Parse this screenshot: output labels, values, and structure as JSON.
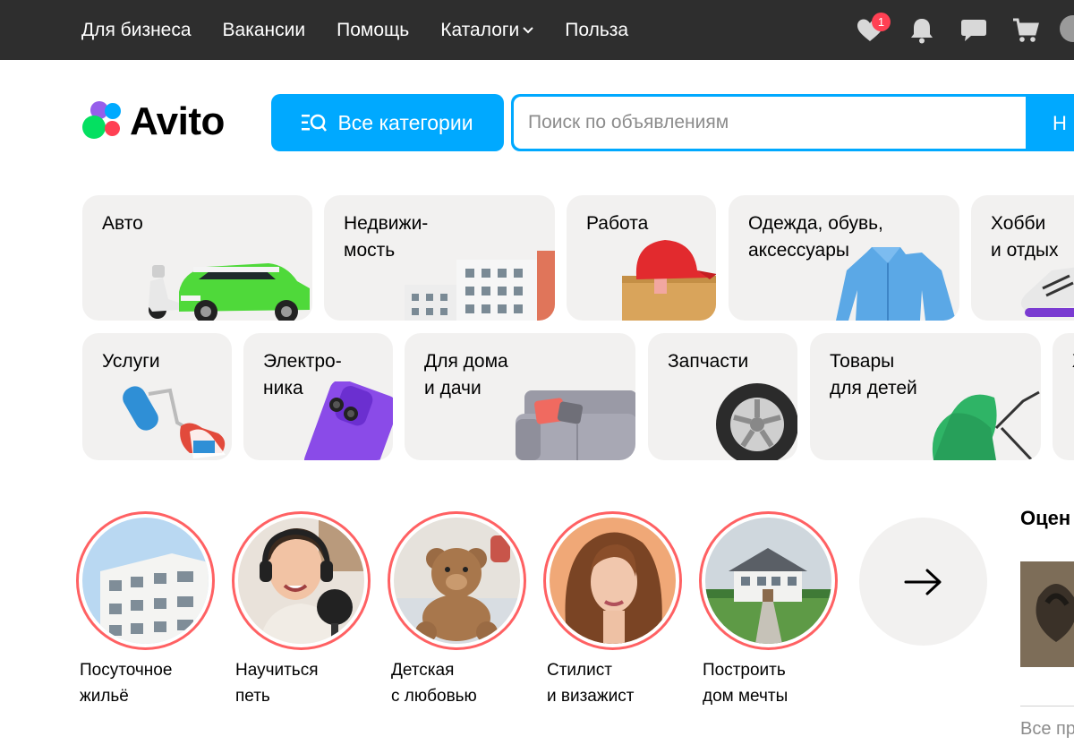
{
  "topbar": {
    "links": [
      "Для бизнеса",
      "Вакансии",
      "Помощь",
      "Каталоги",
      "Польза"
    ],
    "favorites_badge": "1"
  },
  "header": {
    "logo_text": "Avito",
    "all_categories_label": "Все категории",
    "search_placeholder": "Поиск по объявлениям",
    "search_button_partial": "Н"
  },
  "categories": {
    "row1": [
      "Авто",
      "Недвижи-\nмость",
      "Работа",
      "Одежда, обувь,\nаксессуары",
      "Хобби\nи отдых"
    ],
    "row2": [
      "Услуги",
      "Электро-\nника",
      "Для дома\nи дачи",
      "Запчасти",
      "Товары\nдля детей",
      "Ж"
    ]
  },
  "stories": [
    "Посуточное\nжильё",
    "Научиться\nпеть",
    "Детская\nс любовью",
    "Стилист\nи визажист",
    "Построить\nдом мечты"
  ],
  "sidebar": {
    "title_partial": "Оцен",
    "all_link_partial": "Все пр"
  },
  "colors": {
    "accent": "#00a9ff",
    "topbar": "#2e2e2e",
    "story_ring": "#ff6163",
    "card_bg": "#f2f1f0",
    "badge": "#ff4053"
  }
}
